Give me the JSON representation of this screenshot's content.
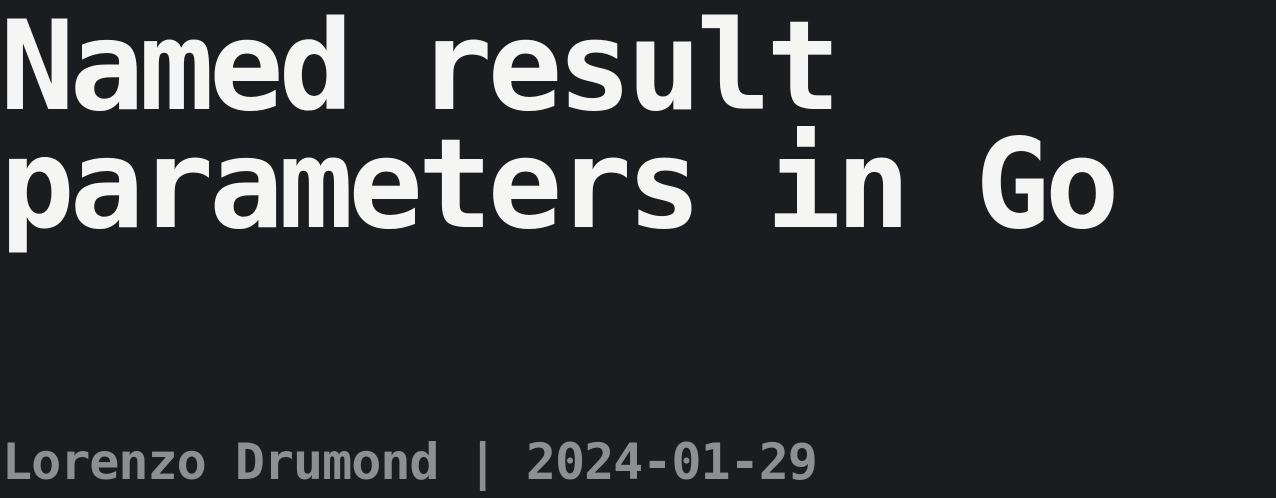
{
  "post": {
    "title_line_1": "Named result",
    "title_line_2": "parameters in Go",
    "author": "Lorenzo Drumond",
    "separator": "|",
    "date": "2024-01-29"
  },
  "colors": {
    "background": "#1b1c20",
    "title": "#f5f5f4",
    "meta": "#8d8f93"
  }
}
